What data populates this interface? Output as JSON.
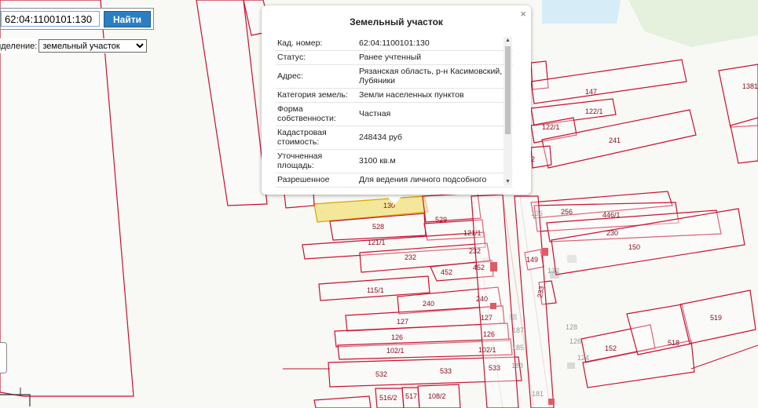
{
  "search": {
    "value": "62:04:1100101:130",
    "button_label": "Найти"
  },
  "layer": {
    "label": "Выделение:",
    "selected": "земельный участок"
  },
  "popup": {
    "title": "Земельный участок",
    "close_glyph": "×",
    "rows": [
      {
        "key": "Кад. номер:",
        "value": "62:04:1100101:130"
      },
      {
        "key": "Статус:",
        "value": "Ранее учтенный"
      },
      {
        "key": "Адрес:",
        "value": "Рязанская область, р-н Касимовский, с Лубяники"
      },
      {
        "key": "Категория земель:",
        "value": "Земли населенных пунктов"
      },
      {
        "key": "Форма собственности:",
        "value": "Частная"
      },
      {
        "key": "Кадастровая стоимость:",
        "value": "248434 руб"
      },
      {
        "key": "Уточненная площадь:",
        "value": "3100 кв.м"
      },
      {
        "key": "Разрешенное",
        "value": "Для ведения личного подсобного"
      }
    ]
  },
  "map": {
    "plot_labels": [
      "130",
      "529",
      "528",
      "121/1",
      "121/1",
      "232",
      "232",
      "452",
      "452",
      "115/1",
      "240",
      "240",
      "127",
      "127",
      "126",
      "126",
      "102/1",
      "102/1",
      "532",
      "533",
      "533",
      "516/2",
      "517",
      "108/2",
      "147",
      "122/1",
      "122/1",
      "241",
      "256",
      "446/1",
      "230",
      "150",
      "149",
      "233",
      "519",
      "518",
      "152",
      "1381",
      "2"
    ],
    "service_labels": [
      "136",
      "132",
      "128",
      "126",
      "124",
      "187",
      "185",
      "183",
      "181"
    ]
  }
}
